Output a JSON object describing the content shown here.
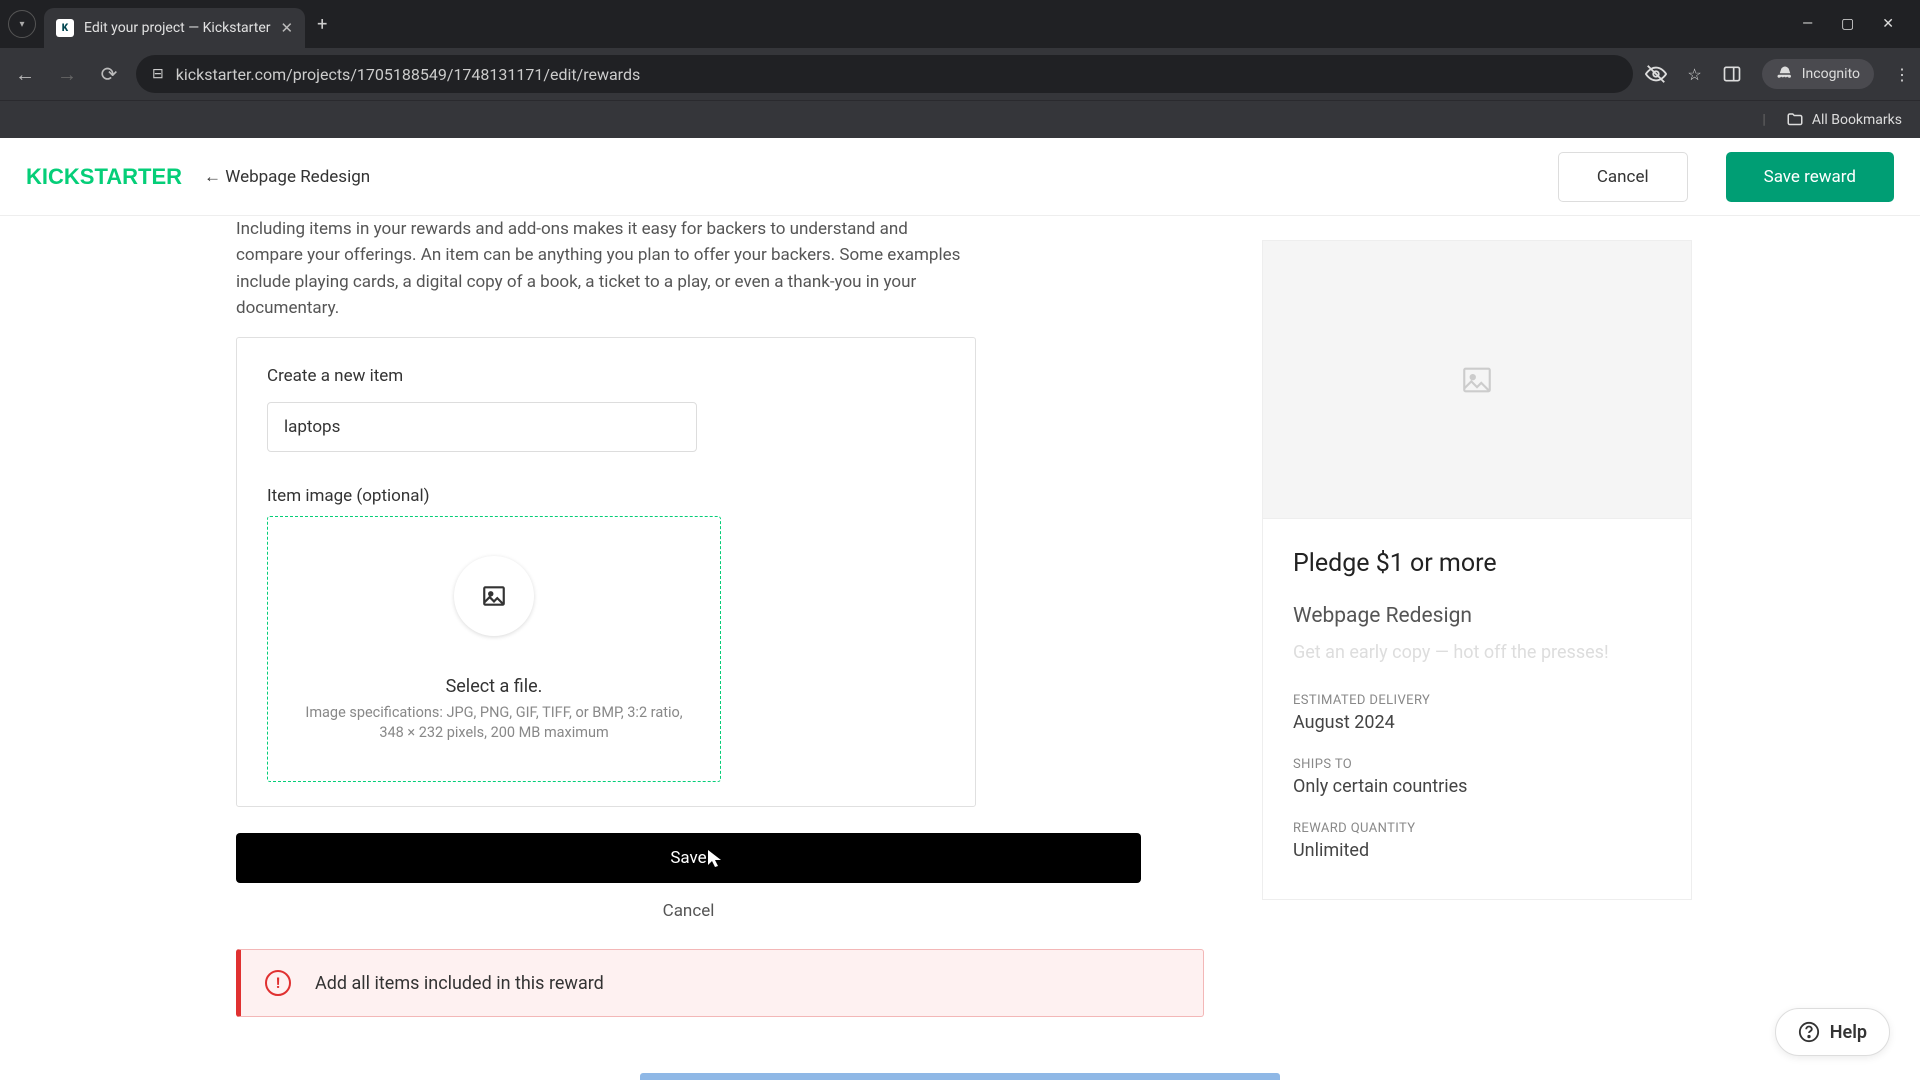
{
  "browser": {
    "tab_title": "Edit your project — Kickstarter",
    "url_display": "kickstarter.com/projects/1705188549/1748131171/edit/rewards",
    "incognito_label": "Incognito",
    "all_bookmarks": "All Bookmarks"
  },
  "header": {
    "logo_text": "KICKSTARTER",
    "back_arrow": "←",
    "back_label": "Webpage Redesign",
    "cancel_label": "Cancel",
    "save_reward_label": "Save reward"
  },
  "main": {
    "intro_text": "Including items in your rewards and add-ons makes it easy for backers to understand and compare your offerings. An item can be anything you plan to offer your backers. Some examples include playing cards, a digital copy of a book, a ticket to a play, or even a thank-you in your documentary.",
    "create_item_label": "Create a new item",
    "item_name_value": "laptops",
    "item_image_label": "Item image (optional)",
    "dropzone": {
      "select_file": "Select a file.",
      "spec": "Image specifications: JPG, PNG, GIF, TIFF, or BMP, 3:2 ratio, 348 × 232 pixels, 200 MB maximum"
    },
    "save_label": "Save",
    "cancel_label": "Cancel",
    "alert_text": "Add all items included in this reward"
  },
  "preview": {
    "pledge_title": "Pledge $1 or more",
    "reward_name": "Webpage Redesign",
    "reward_desc": "Get an early copy — hot off the presses!",
    "delivery_label": "ESTIMATED DELIVERY",
    "delivery_value": "August 2024",
    "ships_label": "SHIPS TO",
    "ships_value": "Only certain countries",
    "quantity_label": "REWARD QUANTITY",
    "quantity_value": "Unlimited"
  },
  "help_label": "Help"
}
